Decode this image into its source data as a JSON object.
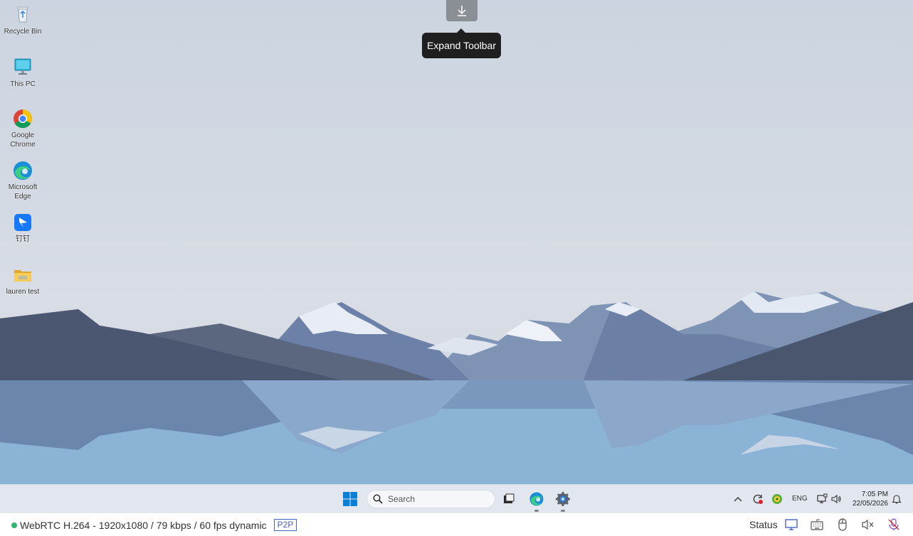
{
  "desktop": {
    "icons": [
      {
        "label": "Recycle Bin",
        "icon": "recycle-bin-icon"
      },
      {
        "label": "This PC",
        "icon": "this-pc-icon"
      },
      {
        "label": "Google Chrome",
        "icon": "chrome-icon"
      },
      {
        "label": "Microsoft Edge",
        "icon": "edge-icon"
      },
      {
        "label": "钉钉",
        "icon": "dingtalk-icon"
      },
      {
        "label": "lauren test",
        "icon": "folder-icon"
      }
    ]
  },
  "toolbar": {
    "expand_icon": "download-arrow-icon",
    "tooltip": "Expand Toolbar"
  },
  "taskbar": {
    "search_placeholder": "Search",
    "tray": {
      "language": "ENG",
      "time": "7:05 PM",
      "date": "22/05/2026"
    }
  },
  "statusbar": {
    "stream_info": "WebRTC H.264 - 1920x1080 /  79 kbps / 60 fps dynamic",
    "mode_badge": "P2P",
    "status_label": "Status"
  },
  "colors": {
    "connected": "#2fb36f",
    "accent": "#4a63c5",
    "tooltip_bg": "#1f1f1f"
  }
}
